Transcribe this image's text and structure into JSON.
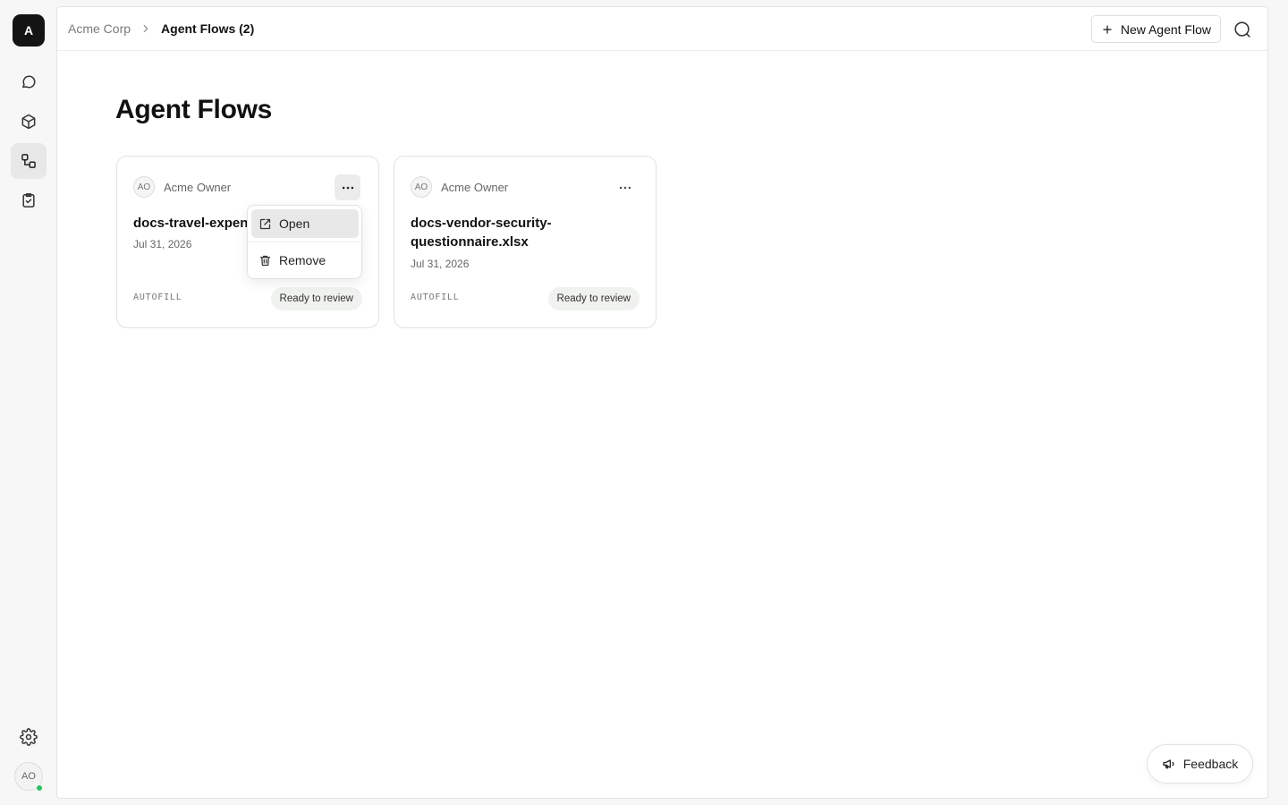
{
  "app": {
    "logo_letter": "A",
    "user_initials": "AO"
  },
  "breadcrumb": {
    "workspace": "Acme Corp",
    "current": "Agent Flows (2)"
  },
  "toolbar": {
    "new_label": "New Agent Flow"
  },
  "page": {
    "title": "Agent Flows"
  },
  "cards": [
    {
      "owner_initials": "AO",
      "owner": "Acme Owner",
      "name": "docs-travel-expen",
      "date": "Jul 31, 2026",
      "type": "AUTOFILL",
      "status": "Ready to review"
    },
    {
      "owner_initials": "AO",
      "owner": "Acme Owner",
      "name": "docs-vendor-security-questionnaire.xlsx",
      "date": "Jul 31, 2026",
      "type": "AUTOFILL",
      "status": "Ready to review"
    }
  ],
  "menu": {
    "open_label": "Open",
    "remove_label": "Remove"
  },
  "feedback": {
    "label": "Feedback"
  },
  "colors": {
    "online": "#22c55e",
    "logo_bg": "#141414"
  },
  "icons": {
    "rail": [
      "chat-bubble-icon",
      "cube-icon",
      "flow-icon",
      "clipboard-check-icon"
    ],
    "settings": "gear-icon",
    "search": "search-icon",
    "new": "plus-icon",
    "open": "external-link-icon",
    "remove": "trash-icon",
    "feedback": "megaphone-icon"
  }
}
